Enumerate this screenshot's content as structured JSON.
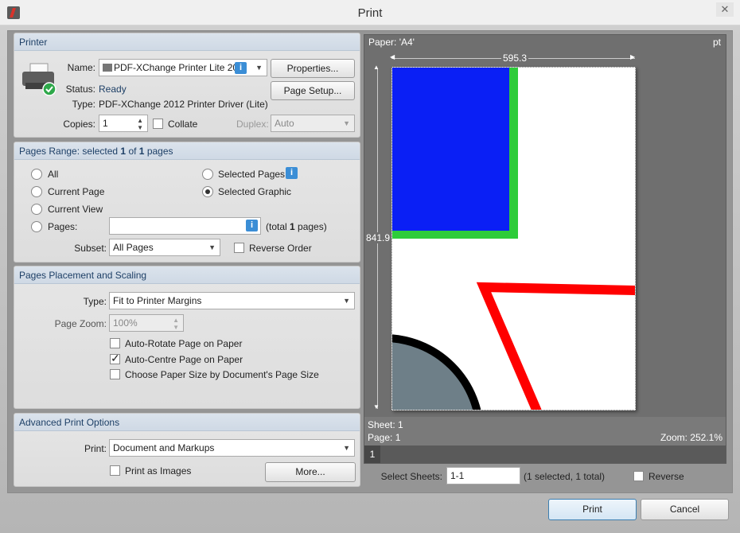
{
  "window": {
    "title": "Print"
  },
  "printer": {
    "section_title": "Printer",
    "name_label": "Name:",
    "name_value": "PDF-XChange Printer Lite 20",
    "status_label": "Status:",
    "status_value": "Ready",
    "type_label": "Type:",
    "type_value": "PDF-XChange 2012 Printer Driver (Lite)",
    "copies_label": "Copies:",
    "copies_value": "1",
    "collate_label": "Collate",
    "duplex_label": "Duplex:",
    "duplex_value": "Auto",
    "properties_button": "Properties...",
    "page_setup_button": "Page Setup..."
  },
  "pages_range": {
    "title_prefix": "Pages Range: selected ",
    "selected": "1",
    "title_mid": " of ",
    "total": "1",
    "title_suffix": " pages",
    "all": "All",
    "current_page": "Current Page",
    "current_view": "Current View",
    "pages": "Pages:",
    "selected_pages": "Selected Pages",
    "selected_graphic": "Selected Graphic",
    "total_prefix": "(total ",
    "total_count": "1",
    "total_suffix": " pages)",
    "subset_label": "Subset:",
    "subset_value": "All Pages",
    "reverse_order": "Reverse Order"
  },
  "placement": {
    "section_title": "Pages Placement and Scaling",
    "type_label": "Type:",
    "type_value": "Fit to Printer Margins",
    "zoom_label": "Page Zoom:",
    "zoom_value": "100%",
    "auto_rotate": "Auto-Rotate Page on Paper",
    "auto_centre": "Auto-Centre Page on Paper",
    "choose_paper": "Choose Paper Size by Document's Page Size"
  },
  "advanced": {
    "section_title": "Advanced Print Options",
    "print_label": "Print:",
    "print_value": "Document and Markups",
    "print_as_images": "Print as Images",
    "more_button": "More..."
  },
  "preview": {
    "paper_label": "Paper: 'A4'",
    "unit": "pt",
    "width": "595.3",
    "height": "841.9",
    "sheet": "Sheet: 1",
    "page": "Page: 1",
    "zoom": "Zoom: 252.1%",
    "tab": "1"
  },
  "sheets": {
    "label": "Select Sheets:",
    "value": "1-1",
    "info": "(1 selected, 1 total)",
    "reverse": "Reverse"
  },
  "footer": {
    "print_button": "Print",
    "cancel_button": "Cancel"
  },
  "colors": {
    "blue_rect": "#0a1ff5",
    "green_border": "#2ecc3a",
    "red_line": "#ff0000",
    "circle_fill": "#6e7f88"
  }
}
